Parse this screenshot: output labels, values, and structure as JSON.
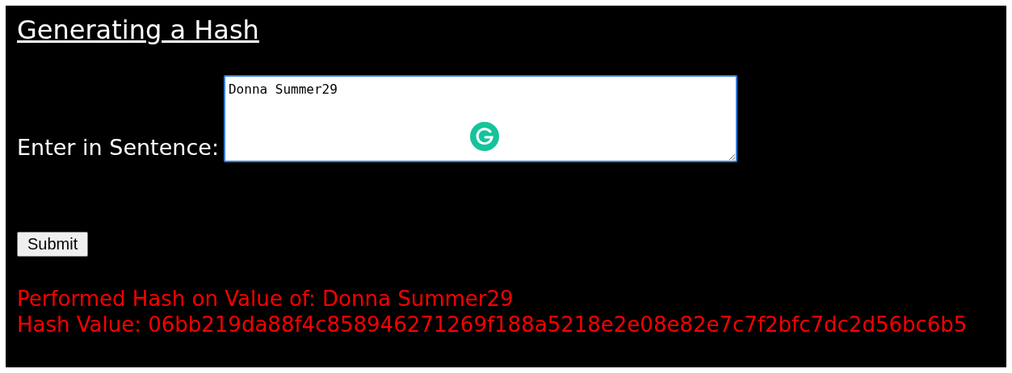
{
  "title": "Generating a Hash",
  "form": {
    "label": "Enter in Sentence:",
    "value": "Donna Summer29",
    "focused": true
  },
  "submit_button": "Submit",
  "results": [
    "Performed Hash on Value of: Donna Summer29",
    "Hash Value: 06bb219da88f4c858946271269f188a5218e2e08e82e7c7f2bfc7dc2d56bc6b5"
  ]
}
